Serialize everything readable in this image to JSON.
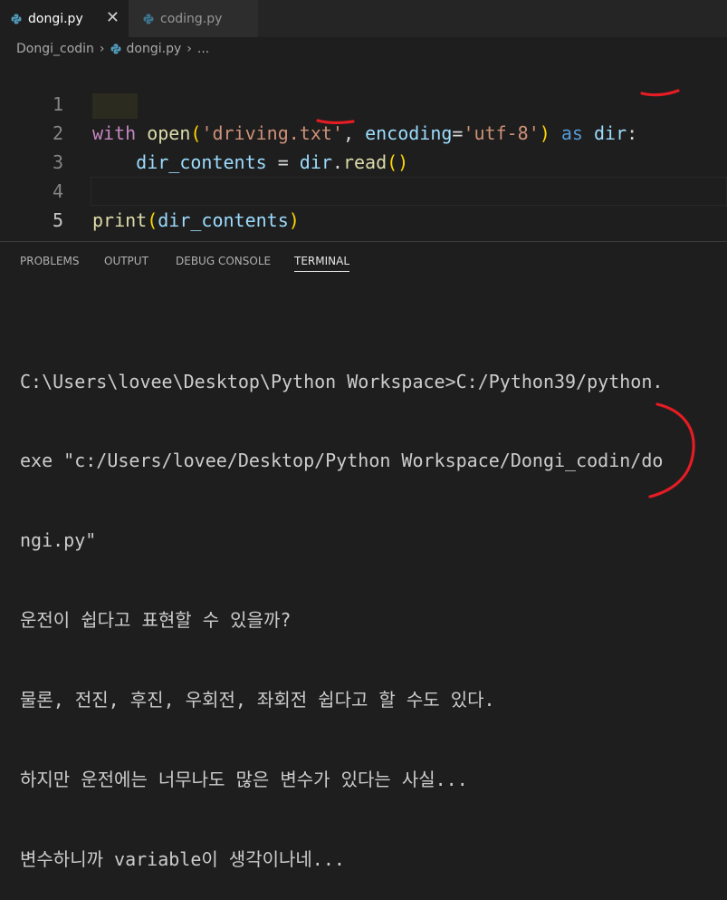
{
  "tabs": [
    {
      "label": "dongi.py",
      "active": true,
      "close": "✕"
    },
    {
      "label": "coding.py",
      "active": false
    }
  ],
  "breadcrumb": {
    "folder": "Dongi_codin",
    "file": "dongi.py",
    "more": "..."
  },
  "editor": {
    "current_line": 5,
    "lines": [
      {
        "number": "1",
        "tokens": [
          {
            "text": "with",
            "kind": "k-purple"
          },
          {
            "text": " ",
            "kind": "k-op"
          },
          {
            "text": "open",
            "kind": "k-func"
          },
          {
            "text": "(",
            "kind": "k-paren"
          },
          {
            "text": "'driving.txt'",
            "kind": "k-str"
          },
          {
            "text": ", ",
            "kind": "k-op"
          },
          {
            "text": "encoding",
            "kind": "k-var"
          },
          {
            "text": "=",
            "kind": "k-op"
          },
          {
            "text": "'utf-8'",
            "kind": "k-str"
          },
          {
            "text": ")",
            "kind": "k-paren"
          },
          {
            "text": " ",
            "kind": "k-op"
          },
          {
            "text": "as",
            "kind": "k-blue"
          },
          {
            "text": " ",
            "kind": "k-op"
          },
          {
            "text": "dir",
            "kind": "k-var"
          },
          {
            "text": ":",
            "kind": "k-op"
          }
        ]
      },
      {
        "number": "2",
        "tokens": [
          {
            "text": "    ",
            "kind": "k-op"
          },
          {
            "text": "dir_contents",
            "kind": "k-var"
          },
          {
            "text": " = ",
            "kind": "k-op"
          },
          {
            "text": "dir",
            "kind": "k-var"
          },
          {
            "text": ".",
            "kind": "k-op"
          },
          {
            "text": "read",
            "kind": "k-func"
          },
          {
            "text": "()",
            "kind": "k-paren"
          }
        ]
      },
      {
        "number": "3",
        "tokens": []
      },
      {
        "number": "4",
        "tokens": [
          {
            "text": "print",
            "kind": "k-func"
          },
          {
            "text": "(",
            "kind": "k-paren"
          },
          {
            "text": "dir_contents",
            "kind": "k-var"
          },
          {
            "text": ")",
            "kind": "k-paren"
          }
        ]
      },
      {
        "number": "5",
        "tokens": []
      }
    ]
  },
  "panel": {
    "tabs": [
      {
        "label": "PROBLEMS",
        "active": false
      },
      {
        "label": "OUTPUT",
        "active": false
      },
      {
        "label": "DEBUG CONSOLE",
        "active": false
      },
      {
        "label": "TERMINAL",
        "active": true
      }
    ]
  },
  "terminal": {
    "lines": [
      "C:\\Users\\lovee\\Desktop\\Python Workspace>C:/Python39/python.",
      "exe \"c:/Users/lovee/Desktop/Python Workspace/Dongi_codin/do",
      "ngi.py\"",
      "운전이 쉽다고 표현할 수 있을까?",
      "물론, 전진, 후진, 우회전, 좌회전 쉽다고 할 수도 있다.",
      "하지만 운전에는 너무나도 많은 변수가 있다는 사실...",
      "변수하니까 variable이 생각이나네..."
    ]
  },
  "colors": {
    "background": "#1e1e1e",
    "annotation": "#e51c23"
  },
  "icons": [
    "python-file-icon",
    "close-icon",
    "chevron-right-icon"
  ]
}
